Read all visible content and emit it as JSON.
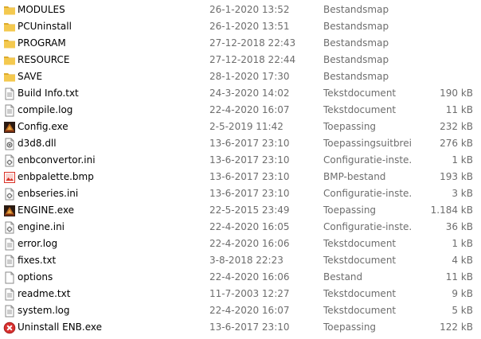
{
  "files": [
    {
      "name": "MODULES",
      "date": "26-1-2020 13:52",
      "type": "Bestandsmap",
      "size": "",
      "icon": "folder-icon"
    },
    {
      "name": "PCUninstall",
      "date": "26-1-2020 13:51",
      "type": "Bestandsmap",
      "size": "",
      "icon": "folder-icon"
    },
    {
      "name": "PROGRAM",
      "date": "27-12-2018 22:43",
      "type": "Bestandsmap",
      "size": "",
      "icon": "folder-icon"
    },
    {
      "name": "RESOURCE",
      "date": "27-12-2018 22:44",
      "type": "Bestandsmap",
      "size": "",
      "icon": "folder-icon"
    },
    {
      "name": "SAVE",
      "date": "28-1-2020 17:30",
      "type": "Bestandsmap",
      "size": "",
      "icon": "folder-icon"
    },
    {
      "name": "Build Info.txt",
      "date": "24-3-2020 14:02",
      "type": "Tekstdocument",
      "size": "190 kB",
      "icon": "text-file-icon"
    },
    {
      "name": "compile.log",
      "date": "22-4-2020 16:07",
      "type": "Tekstdocument",
      "size": "11 kB",
      "icon": "text-file-icon"
    },
    {
      "name": "Config.exe",
      "date": "2-5-2019 11:42",
      "type": "Toepassing",
      "size": "232 kB",
      "icon": "app-icon"
    },
    {
      "name": "d3d8.dll",
      "date": "13-6-2017 23:10",
      "type": "Toepassingsuitbrei...",
      "size": "276 kB",
      "icon": "dll-gear-icon"
    },
    {
      "name": "enbconvertor.ini",
      "date": "13-6-2017 23:10",
      "type": "Configuratie-inste...",
      "size": "1 kB",
      "icon": "settings-file-icon"
    },
    {
      "name": "enbpalette.bmp",
      "date": "13-6-2017 23:10",
      "type": "BMP-bestand",
      "size": "193 kB",
      "icon": "bitmap-image-icon"
    },
    {
      "name": "enbseries.ini",
      "date": "13-6-2017 23:10",
      "type": "Configuratie-inste...",
      "size": "3 kB",
      "icon": "settings-file-icon"
    },
    {
      "name": "ENGINE.exe",
      "date": "22-5-2015 23:49",
      "type": "Toepassing",
      "size": "1.184 kB",
      "icon": "app-icon"
    },
    {
      "name": "engine.ini",
      "date": "22-4-2020 16:05",
      "type": "Configuratie-inste...",
      "size": "36 kB",
      "icon": "settings-file-icon"
    },
    {
      "name": "error.log",
      "date": "22-4-2020 16:06",
      "type": "Tekstdocument",
      "size": "1 kB",
      "icon": "text-file-icon"
    },
    {
      "name": "fixes.txt",
      "date": "3-8-2018 22:23",
      "type": "Tekstdocument",
      "size": "4 kB",
      "icon": "text-file-icon"
    },
    {
      "name": "options",
      "date": "22-4-2020 16:06",
      "type": "Bestand",
      "size": "11 kB",
      "icon": "blank-file-icon"
    },
    {
      "name": "readme.txt",
      "date": "11-7-2003 12:27",
      "type": "Tekstdocument",
      "size": "9 kB",
      "icon": "text-file-icon"
    },
    {
      "name": "system.log",
      "date": "22-4-2020 16:07",
      "type": "Tekstdocument",
      "size": "5 kB",
      "icon": "text-file-icon"
    },
    {
      "name": "Uninstall ENB.exe",
      "date": "13-6-2017 23:10",
      "type": "Toepassing",
      "size": "122 kB",
      "icon": "uninstall-icon"
    }
  ],
  "colors": {
    "folder": "#f4c94f",
    "folder_dark": "#dcaa2c",
    "secondary_text": "#6d6d6d",
    "bitmap_red": "#d93025",
    "uninstall_red": "#d8302f"
  }
}
